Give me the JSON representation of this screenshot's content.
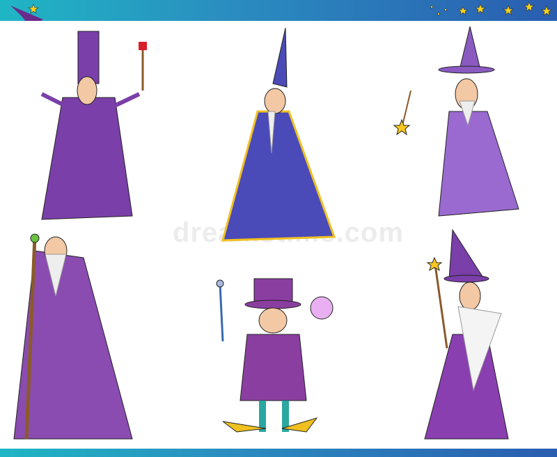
{
  "watermark": "dreamstime.com",
  "colors": {
    "band_start": "#1fb6c4",
    "band_end": "#2a5db0",
    "robe_purple": "#7a3fa8",
    "robe_blue": "#4a4ab8",
    "star": "#f7c81e"
  },
  "figures": [
    "wizard-with-red-wand",
    "wizard-blue-robe-pointed-hat",
    "wizard-starry-robe-wand",
    "old-wizard-with-staff",
    "magician-top-hat-crystal-ball",
    "bearded-wizard-starry-robe"
  ]
}
